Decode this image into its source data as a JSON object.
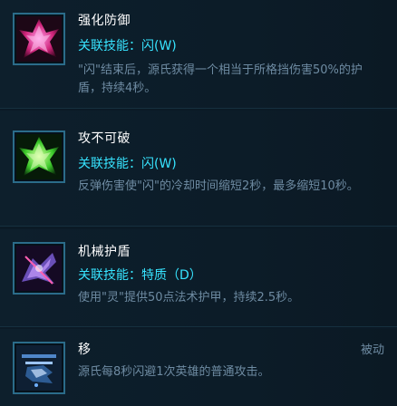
{
  "talents": [
    {
      "title": "强化防御",
      "linked": "关联技能：闪(W)",
      "desc": "\"闪\"结束后，源氏获得一个相当于所格挡伤害50%的护盾，持续4秒。",
      "icon": "magenta-crystal-shield-icon"
    },
    {
      "title": "攻不可破",
      "linked": "关联技能：闪(W)",
      "desc": "反弹伤害使\"闪\"的冷却时间缩短2秒，最多缩短10秒。",
      "icon": "green-crystal-shield-icon"
    },
    {
      "title": "机械护盾",
      "linked": "关联技能：特质（D）",
      "desc": "使用\"灵\"提供50点法术护甲，持续2.5秒。",
      "icon": "cyber-ninja-shield-icon"
    },
    {
      "title": "移",
      "passive": "被动",
      "desc": "源氏每8秒闪避1次英雄的普通攻击。",
      "icon": "ninja-dodge-icon"
    }
  ],
  "colors": {
    "title": "#ffffff",
    "linked": "#37e4ff",
    "desc": "#6e8ba2",
    "icon_border": "#2b6c8a"
  }
}
